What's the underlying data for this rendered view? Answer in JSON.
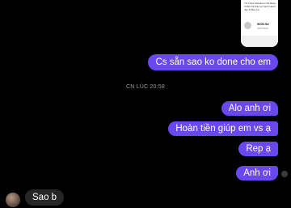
{
  "product_card": {
    "title": "Túi Chéo Kawaivivi nhà Basu 3 Mini Kit Dây lục bạch Heart Jay Xi Bén ba",
    "price": "9000.5d",
    "subtitle": "2000.5DM"
  },
  "messages": {
    "out_1": "Cs sẵn sao ko done cho em",
    "timestamp": "CN LÚC 20:58",
    "out_2": "Alo anh ơi",
    "out_3": "Hoàn tiền giúp em vs ạ",
    "out_4": "Rep ạ",
    "out_5": "Anh ơi",
    "in_1": "Sao b"
  },
  "colors": {
    "background": "#000000",
    "outgoing_bubble": "#6a48f0",
    "incoming_bubble": "#262626",
    "timestamp_text": "#9a9a9a"
  }
}
